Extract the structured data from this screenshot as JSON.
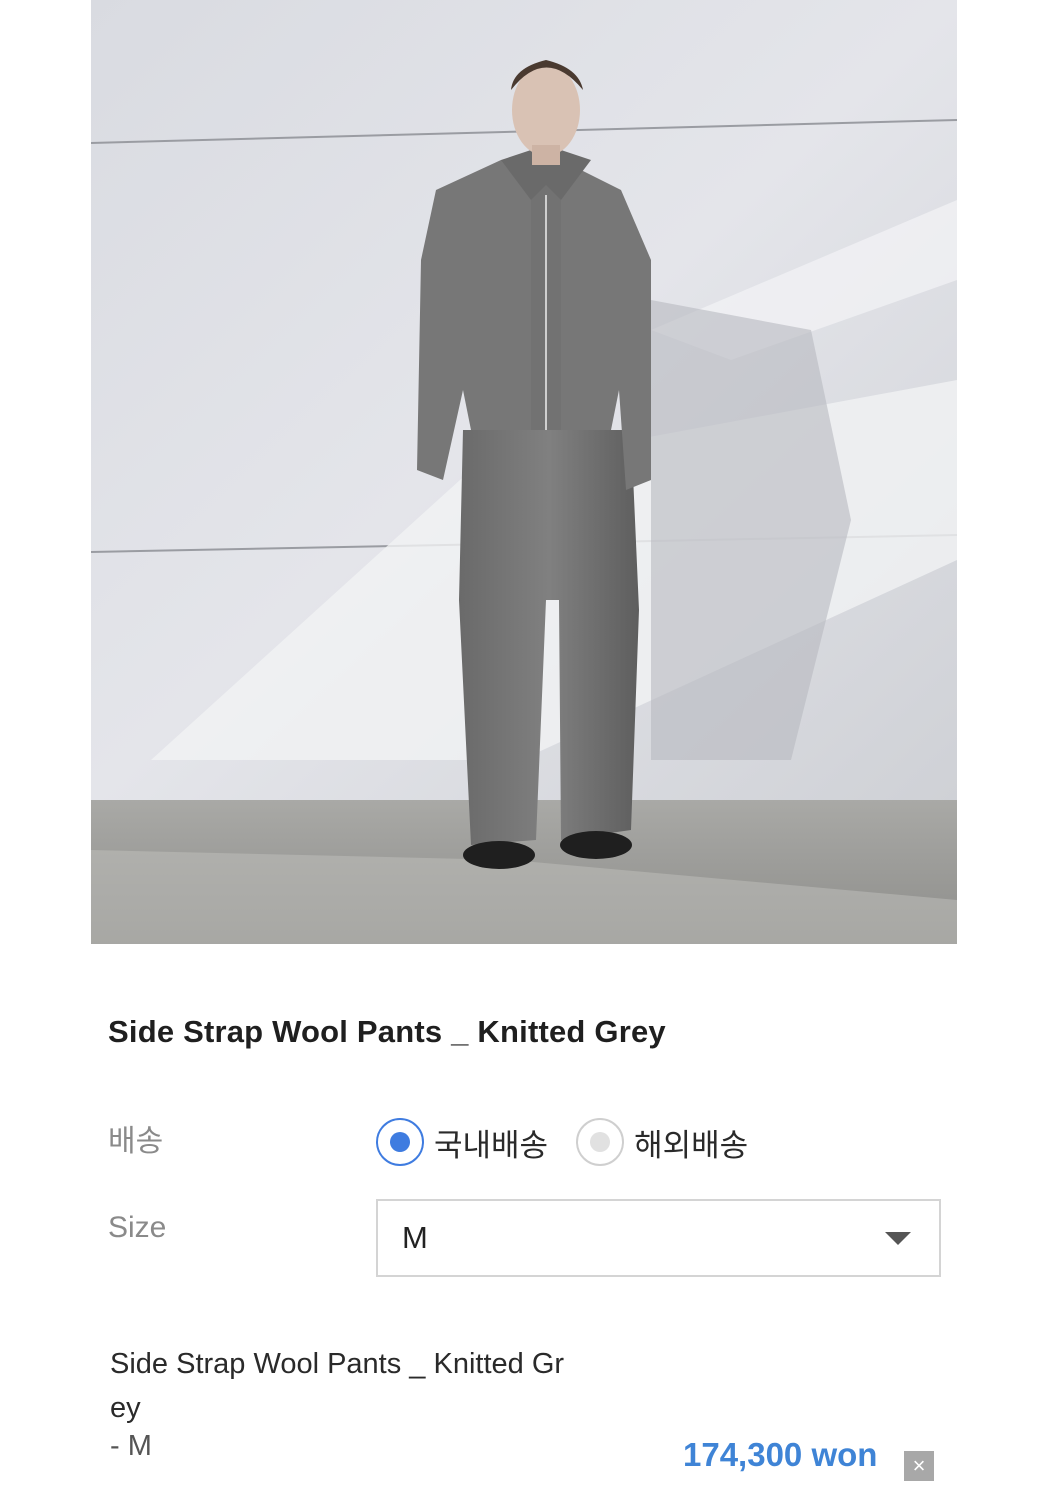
{
  "product": {
    "title": "Side Strap Wool Pants _ Knitted Grey",
    "image_alt": "model-wearing-grey-knitted-wool-jacket-and-pants"
  },
  "shipping": {
    "label": "배송",
    "options": [
      {
        "label": "국내배송",
        "selected": true
      },
      {
        "label": "해외배송",
        "selected": false
      }
    ]
  },
  "size": {
    "label": "Size",
    "selected_value": "M"
  },
  "selected_item": {
    "name": "Side Strap Wool Pants _ Knitted Grey",
    "option": "- M",
    "price": "174,300 won",
    "remove_symbol": "×"
  },
  "colors": {
    "accent": "#3f7ce0",
    "price": "#3f84d6"
  }
}
